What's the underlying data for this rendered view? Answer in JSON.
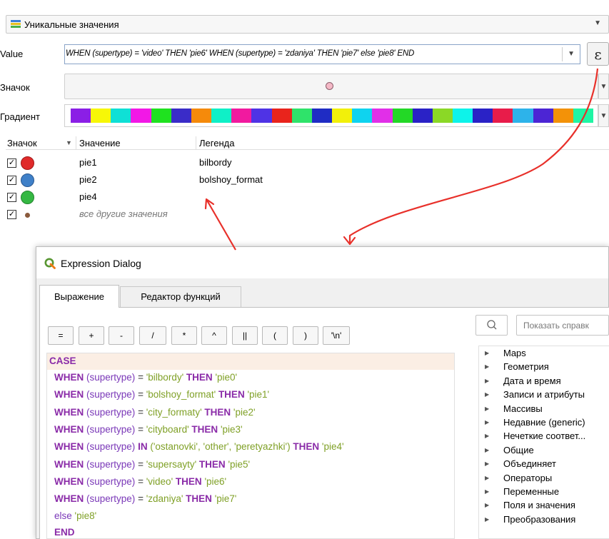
{
  "renderer": {
    "label": "Уникальные значения"
  },
  "value_row": {
    "label": "Value",
    "expression": "WHEN (supertype) = 'video' THEN 'pie6'   WHEN (supertype) = 'zdaniya' THEN 'pie7'   else 'pie8'   END",
    "expr_button": "ε"
  },
  "symbol_row": {
    "label": "Значок"
  },
  "gradient_row": {
    "label": "Градиент",
    "colors": [
      "#8b1fe6",
      "#f7f707",
      "#0fe0d6",
      "#f218e6",
      "#1fe21f",
      "#3a2cc8",
      "#f58a0b",
      "#0ff0c7",
      "#f11a9f",
      "#4f33e5",
      "#e9241c",
      "#2fe36a",
      "#1f2cc4",
      "#f2f00a",
      "#0fd3ef",
      "#e12fe8",
      "#23d826",
      "#2a22c6",
      "#8bd826",
      "#0df3ea",
      "#2a22c6",
      "#e81c4a",
      "#2db3ea",
      "#4c25d4",
      "#f39208",
      "#1ff5a4"
    ]
  },
  "table": {
    "headers": {
      "symbol": "Значок",
      "value": "Значение",
      "legend": "Легенда"
    },
    "rows": [
      {
        "value": "pie1",
        "legend": "bilbordy",
        "color": "#e02a2a"
      },
      {
        "value": "pie2",
        "legend": "bolshoy_format",
        "color": "#3f80c8"
      },
      {
        "value": "pie4",
        "legend": "",
        "color": "#35b843"
      }
    ],
    "other_label": "все другие значения",
    "other_color": "#8a5a3c"
  },
  "dialog": {
    "title": "Expression Dialog",
    "tabs": [
      "Выражение",
      "Редактор функций"
    ],
    "operators": [
      "=",
      "+",
      "-",
      "/",
      "*",
      "^",
      "||",
      "(",
      ")",
      "'\\n'"
    ],
    "help_placeholder": "Показать справк",
    "code": {
      "case": "CASE",
      "when_lines": [
        {
          "op": "=",
          "rhs": "'bilbordy'",
          "res": "'pie0'"
        },
        {
          "op": "=",
          "rhs": "'bolshoy_format'",
          "res": "'pie1'"
        },
        {
          "op": "=",
          "rhs": "'city_formaty'",
          "res": "'pie2'"
        },
        {
          "op": "=",
          "rhs": "'cityboard'",
          "res": "'pie3'"
        },
        {
          "op": "IN",
          "rhs": "('ostanovki', 'other', 'peretyazhki')",
          "res": "'pie4'"
        },
        {
          "op": "=",
          "rhs": "'supersayty'",
          "res": "'pie5'"
        },
        {
          "op": "=",
          "rhs": "'video'",
          "res": "'pie6'"
        },
        {
          "op": "=",
          "rhs": "'zdaniya'",
          "res": "'pie7'"
        }
      ],
      "when_kw": "WHEN",
      "then_kw": "THEN",
      "field": "(supertype)",
      "else_kw": "else",
      "else_val": "'pie8'",
      "end_kw": "END"
    },
    "func_groups": [
      "Maps",
      "Геометрия",
      "Дата и время",
      "Записи и атрибуты",
      "Массивы",
      "Недавние (generic)",
      "Нечеткие соответ...",
      "Общие",
      "Объединяет",
      "Операторы",
      "Переменные",
      "Поля и значения",
      "Преобразования"
    ]
  }
}
